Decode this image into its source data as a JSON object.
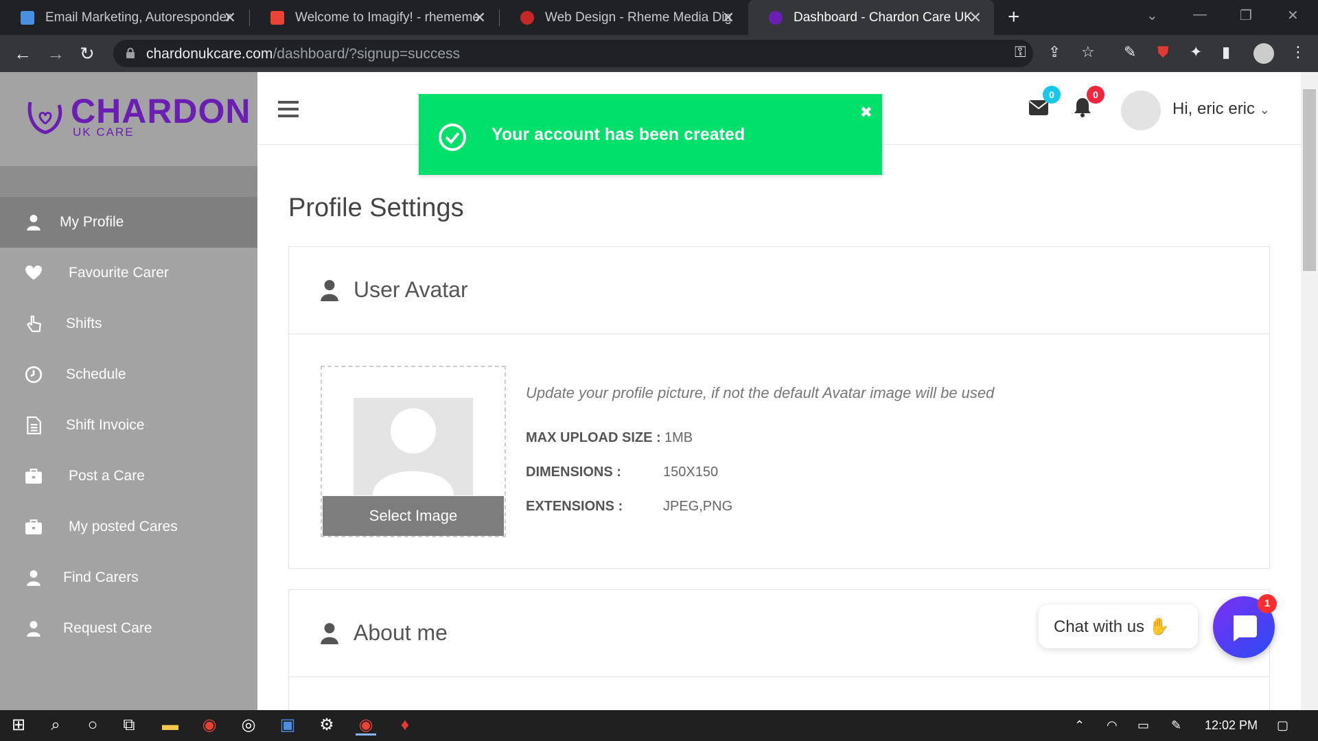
{
  "browser": {
    "tabs": [
      {
        "title": "Email Marketing, Autoresponder",
        "icon": "mail-icon",
        "color": "#4a90e2"
      },
      {
        "title": "Welcome to Imagify! - rhememe",
        "icon": "gmail-icon",
        "color": "#ea4335"
      },
      {
        "title": "Web Design - Rheme Media Digi",
        "icon": "site-icon",
        "color": "#c62828"
      },
      {
        "title": "Dashboard - Chardon Care UK",
        "icon": "chardon-icon",
        "color": "#6a1eb3"
      }
    ],
    "url_host": "chardonukcare.com",
    "url_path": "/dashboard/?signup=success"
  },
  "brand": {
    "name": "CHARDON",
    "sub": "UK CARE",
    "color": "#6a1eb3"
  },
  "sidebar": {
    "items": [
      {
        "label": "My Profile",
        "icon": "user-icon",
        "active": true
      },
      {
        "label": "Favourite Carer",
        "icon": "heart-icon"
      },
      {
        "label": "Shifts",
        "icon": "pointer-hand-icon"
      },
      {
        "label": "Schedule",
        "icon": "clock-icon"
      },
      {
        "label": "Shift Invoice",
        "icon": "document-icon"
      },
      {
        "label": "Post a Care",
        "icon": "briefcase-icon"
      },
      {
        "label": "My posted Cares",
        "icon": "briefcase-icon"
      },
      {
        "label": "Find Carers",
        "icon": "user-icon"
      },
      {
        "label": "Request Care",
        "icon": "user-icon"
      }
    ]
  },
  "header": {
    "mail_count": "0",
    "notif_count": "0",
    "greeting": "Hi, eric eric"
  },
  "toast": {
    "message": "Your account has been created",
    "color": "#00e06a"
  },
  "main": {
    "title": "Profile Settings",
    "avatar_card": {
      "title": "User Avatar",
      "select_label": "Select Image",
      "hint": "Update your profile picture, if not the default Avatar image will be used",
      "specs": [
        {
          "label": "MAX UPLOAD SIZE :",
          "value": "1MB"
        },
        {
          "label": "DIMENSIONS :",
          "value": "150X150"
        },
        {
          "label": "EXTENSIONS :",
          "value": "JPEG,PNG"
        }
      ]
    },
    "about_card": {
      "title": "About me"
    }
  },
  "chat": {
    "text": "Chat with us",
    "badge": "1"
  },
  "taskbar": {
    "time": "12:02 PM"
  }
}
